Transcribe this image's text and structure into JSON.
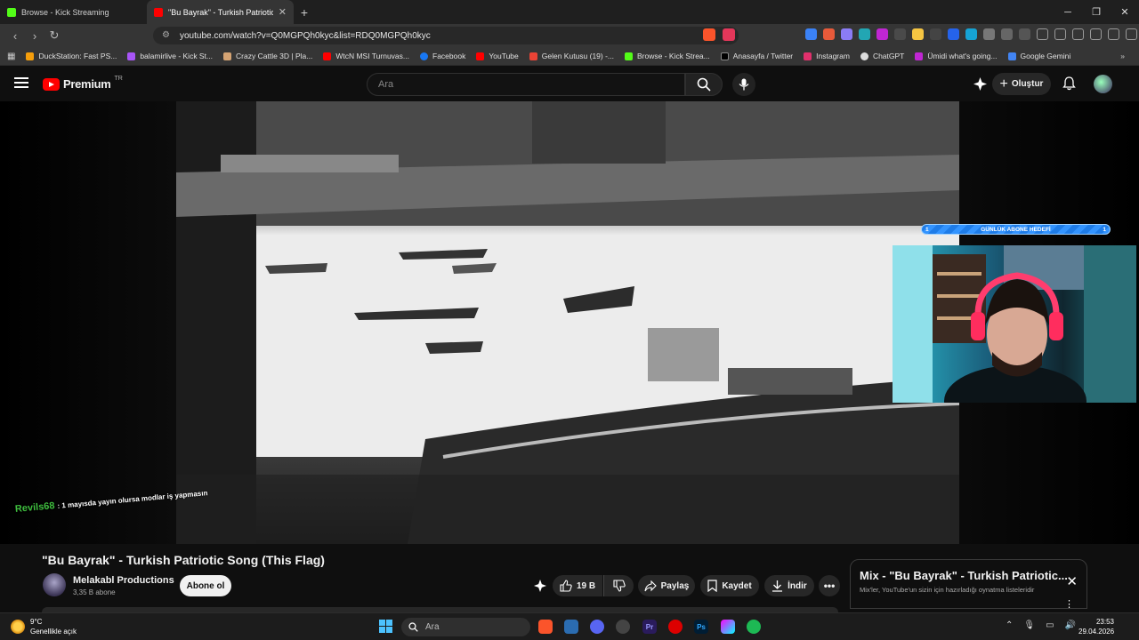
{
  "browser": {
    "tabs": [
      {
        "title": "Browse - Kick Streaming",
        "active": false
      },
      {
        "title": "\"Bu Bayrak\" - Turkish Patriotic So",
        "active": true
      }
    ],
    "url": "youtube.com/watch?v=Q0MGPQh0kyc&list=RDQ0MGPQh0kyc",
    "bookmarks": [
      "DuckStation: Fast PS...",
      "balamirlive - Kick St...",
      "Crazy Cattle 3D | Pla...",
      "WtcN MSI Turnuvas...",
      "Facebook",
      "YouTube",
      "Gelen Kutusu (19) -...",
      "Browse - Kick Strea...",
      "Anasayfa / Twitter",
      "Instagram",
      "ChatGPT",
      "Ümidi what's going...",
      "Google Gemini"
    ]
  },
  "youtube": {
    "logo_text": "Premium",
    "region": "TR",
    "search_placeholder": "Ara",
    "create_label": "Oluştur"
  },
  "overlay": {
    "goal_label": "GÜNLÜK ABONE HEDEFİ",
    "goal_left": "1",
    "goal_right": "1",
    "chat_user": "Revils68",
    "chat_message": ": 1 mayısda yayın olursa modlar iş yapmasın"
  },
  "video": {
    "title": "\"Bu Bayrak\" - Turkish Patriotic Song (This Flag)",
    "channel": "Melakabl Productions",
    "subscribers": "3,35 B abone",
    "subscribe_label": "Abone ol",
    "likes": "19 B",
    "share_label": "Paylaş",
    "save_label": "Kaydet",
    "download_label": "İndir"
  },
  "mix": {
    "title": "Mix - \"Bu Bayrak\" - Turkish Patriotic...",
    "subtitle": "Mix'ler, YouTube'un sizin için hazırladığı oynatma listeleridir"
  },
  "taskbar": {
    "temperature": "9°C",
    "weather": "Genellikle açık",
    "search": "Ara",
    "time": "23:53",
    "date": "29.04.2026"
  },
  "colors": {
    "yt_red": "#ff0000",
    "chat_user": "#3fbf3f",
    "goal_blue": "#1e7ce8"
  }
}
